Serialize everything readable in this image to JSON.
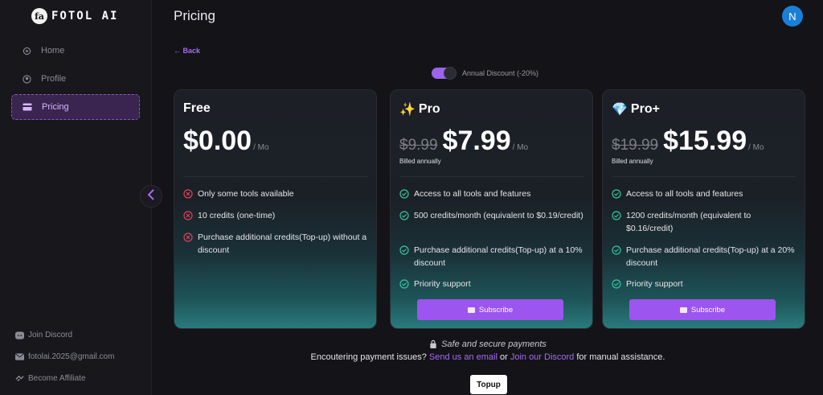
{
  "brand": {
    "name": "FOTOL AI",
    "mark": "fa"
  },
  "sidebar": {
    "items": [
      {
        "label": "Home",
        "icon": "home-icon"
      },
      {
        "label": "Profile",
        "icon": "profile-icon"
      },
      {
        "label": "Pricing",
        "icon": "card-icon",
        "active": true
      }
    ],
    "footer": [
      {
        "label": "Join Discord",
        "icon": "discord-icon"
      },
      {
        "label": "fotolai.2025@gmail.com",
        "icon": "mail-icon"
      },
      {
        "label": "Become Affiliate",
        "icon": "handshake-icon"
      }
    ]
  },
  "header": {
    "title": "Pricing",
    "avatar_initial": "N",
    "back_label": "← Back"
  },
  "toggle": {
    "label": "Annual Discount (-20%)",
    "on": true
  },
  "colors": {
    "accent": "#9c55ee",
    "link": "#a66cf0",
    "avatar": "#1a7fd6",
    "check": "#33c7a0",
    "cross": "#e0405a"
  },
  "plans": [
    {
      "name": "Free",
      "emoji": "",
      "old_price": "",
      "price": "$0.00",
      "per": "/ Mo",
      "billed": "",
      "features": [
        {
          "text": "Only some tools available",
          "ok": false
        },
        {
          "text": "10 credits (one-time)",
          "ok": false
        },
        {
          "text": "Purchase additional credits(Top-up) without a discount",
          "ok": false
        }
      ],
      "button": ""
    },
    {
      "name": "Pro",
      "emoji": "✨",
      "old_price": "$9.99",
      "price": "$7.99",
      "per": "/ Mo",
      "billed": "Billed annually",
      "features": [
        {
          "text": "Access to all tools and features",
          "ok": true
        },
        {
          "text": "500 credits/month (equivalent to $0.19/credit)",
          "ok": true
        },
        {
          "text": "Purchase additional credits(Top-up) at a 10% discount",
          "ok": true
        },
        {
          "text": "Priority support",
          "ok": true
        }
      ],
      "button": "Subscribe"
    },
    {
      "name": "Pro+",
      "emoji": "💎",
      "old_price": "$19.99",
      "price": "$15.99",
      "per": "/ Mo",
      "billed": "Billed annually",
      "features": [
        {
          "text": "Access to all tools and features",
          "ok": true
        },
        {
          "text": "1200 credits/month (equivalent to $0.16/credit)",
          "ok": true
        },
        {
          "text": "Purchase additional credits(Top-up) at a 20% discount",
          "ok": true
        },
        {
          "text": "Priority support",
          "ok": true
        }
      ],
      "button": "Subscribe"
    }
  ],
  "footer": {
    "secure": "Safe and secure payments",
    "issues_prefix": "Encoutering payment issues?",
    "email_link": "Send us an email",
    "or": "or",
    "discord_link": "Join our Discord",
    "issues_suffix": "for manual assistance.",
    "topup": "Topup"
  }
}
